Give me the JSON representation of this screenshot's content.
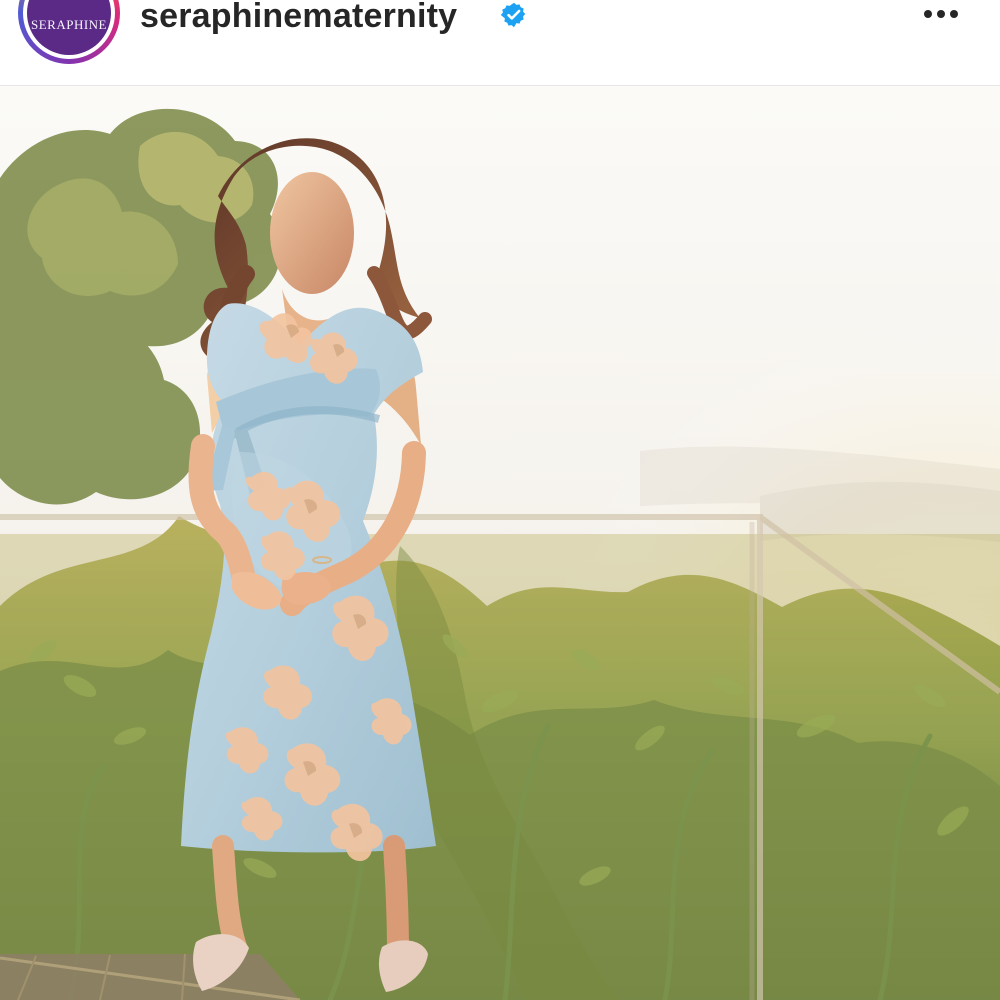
{
  "post": {
    "username": "seraphinematernity",
    "avatar_text": "SERAPHINE",
    "verified_icon": "verified-badge-icon",
    "more_icon": "more-options-icon"
  },
  "image": {
    "description_icon": "maternity-dress-photo"
  },
  "colors": {
    "instagram_gradient": [
      "#f58529",
      "#dd2a7b",
      "#8134af",
      "#515bd4"
    ],
    "verified_blue": "#1da1f2",
    "brand_purple": "#5b2a86",
    "dress_blue": "#b9d2df",
    "floral_peach": "#e8b58b"
  }
}
